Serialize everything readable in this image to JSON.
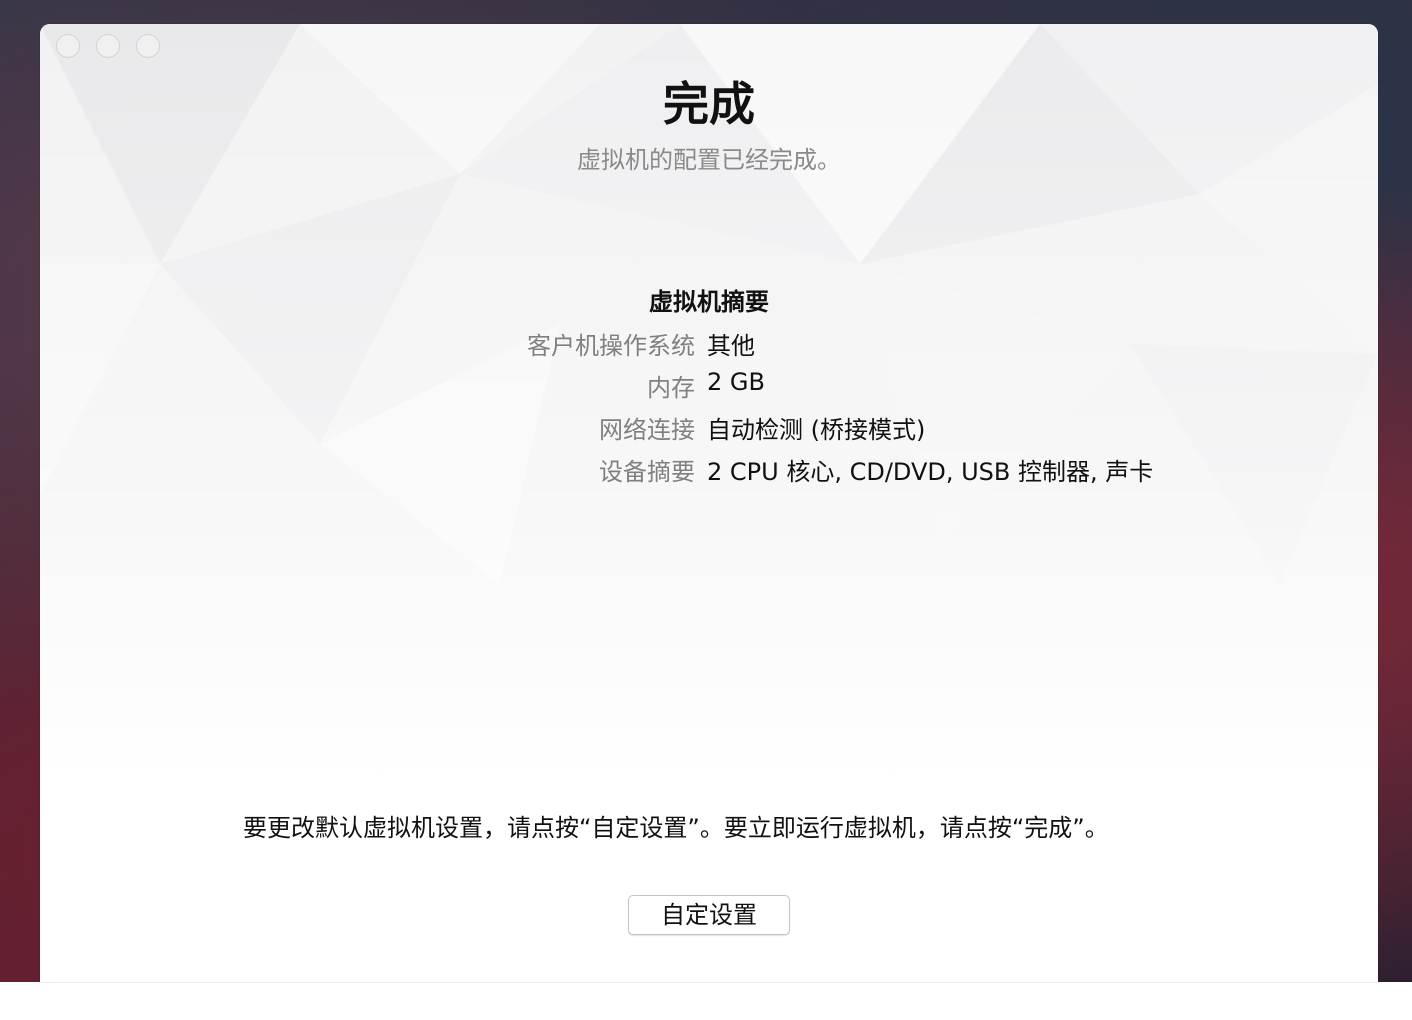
{
  "window": {
    "title": "完成",
    "subtitle": "虚拟机的配置已经完成。"
  },
  "summary": {
    "heading": "虚拟机摘要",
    "rows": [
      {
        "label": "客户机操作系统",
        "value": "其他"
      },
      {
        "label": "内存",
        "value": "2 GB"
      },
      {
        "label": "网络连接",
        "value": "自动检测 (桥接模式)"
      },
      {
        "label": "设备摘要",
        "value": "2 CPU 核心, CD/DVD, USB 控制器, 声卡"
      }
    ]
  },
  "footer": {
    "instructions": "要更改默认虚拟机设置，请点按“自定设置”。要立即运行虚拟机，请点按“完成”。",
    "customize_label": "自定设置"
  }
}
